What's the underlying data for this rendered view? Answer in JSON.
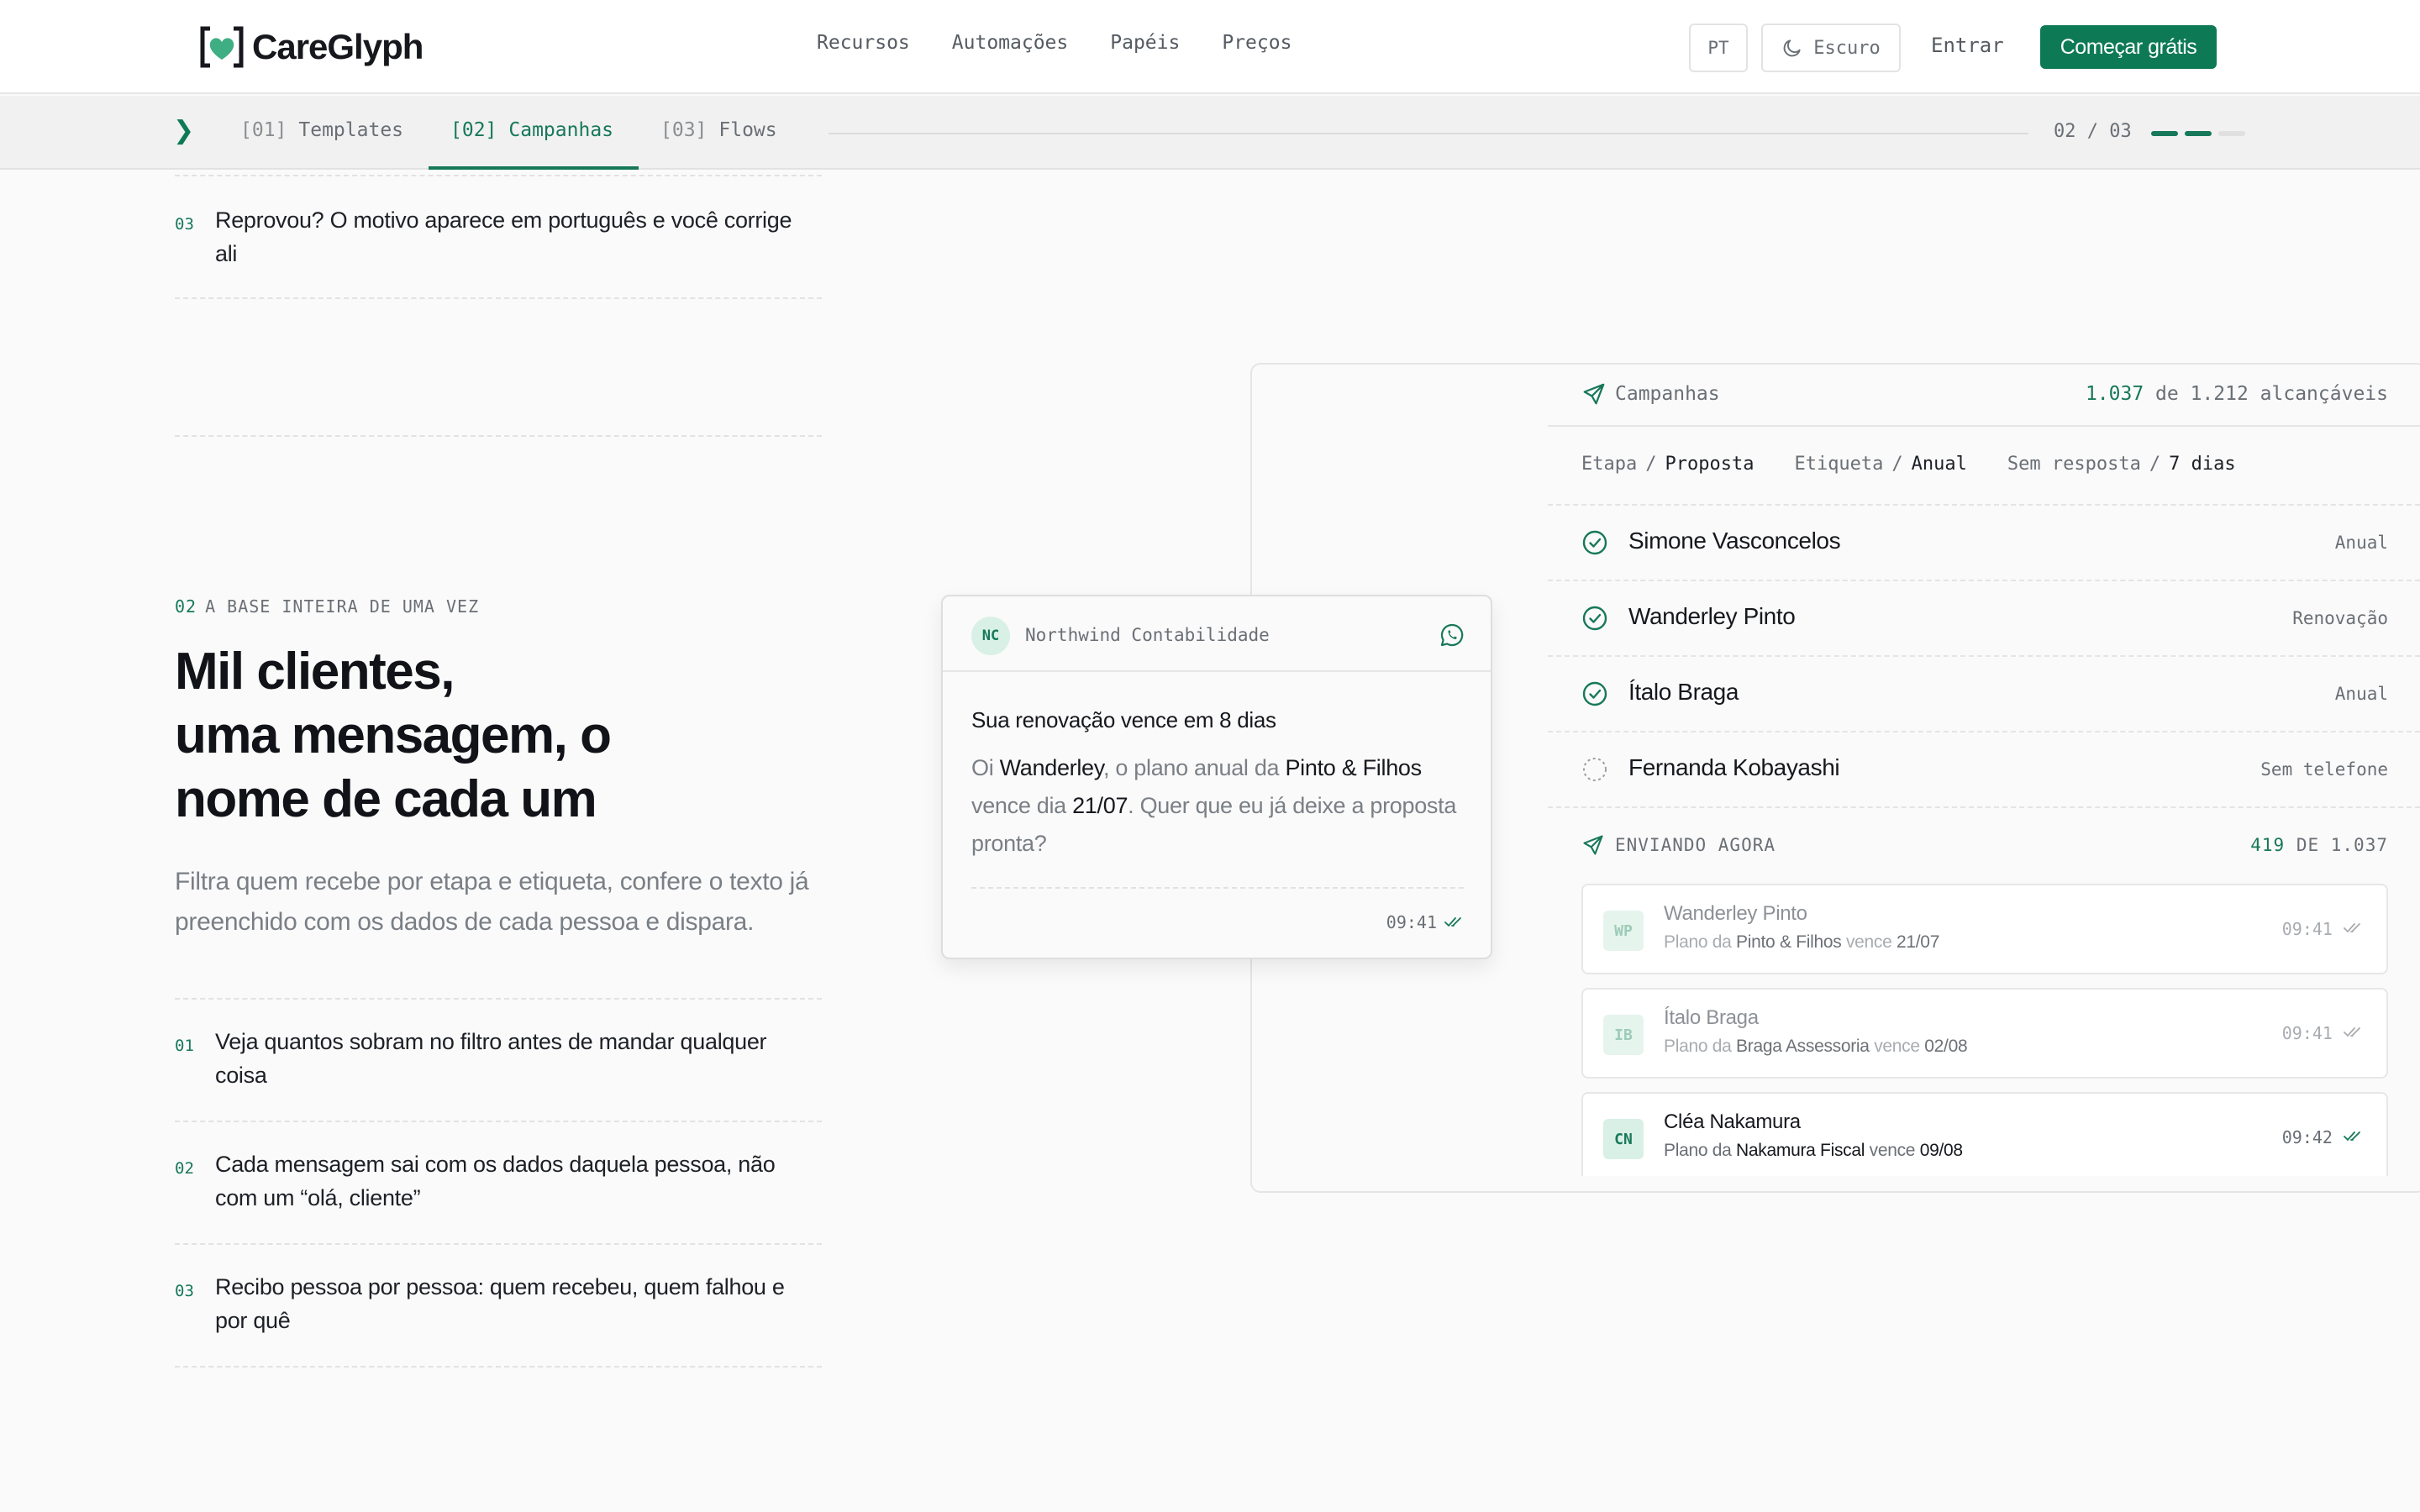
{
  "header": {
    "brand": "CareGlyph",
    "nav": [
      "Recursos",
      "Automações",
      "Papéis",
      "Preços"
    ],
    "lang": "PT",
    "theme": "Escuro",
    "login": "Entrar",
    "cta": "Começar grátis"
  },
  "tabs": {
    "items": [
      {
        "num": "[01]",
        "label": "Templates"
      },
      {
        "num": "[02]",
        "label": "Campanhas"
      },
      {
        "num": "[03]",
        "label": "Flows"
      }
    ],
    "active": 1,
    "counter": "02 / 03",
    "progress": {
      "current": 2,
      "total": 3
    }
  },
  "top_list": {
    "num": "03",
    "text": "Reprovou? O motivo aparece em português e você corrige ali"
  },
  "section": {
    "eyebrow_num": "02",
    "eyebrow": "A BASE INTEIRA DE UMA VEZ",
    "headline_1": "Mil clientes,",
    "headline_2": "uma mensagem, o",
    "headline_3": "nome de cada um",
    "subtext": "Filtra quem recebe por etapa e etiqueta, confere o texto já preenchido com os dados de cada pessoa e dispara.",
    "items": [
      {
        "num": "01",
        "text": "Veja quantos sobram no filtro antes de mandar qualquer coisa"
      },
      {
        "num": "02",
        "text": "Cada mensagem sai com os dados daquela pessoa, não com um “olá, cliente”"
      },
      {
        "num": "03",
        "text": "Recibo pessoa por pessoa: quem recebeu, quem falhou e por quê"
      }
    ]
  },
  "message": {
    "avatar": "NC",
    "org": "Northwind Contabilidade",
    "title": "Sua renovação vence em 8 dias",
    "body_1": "Oi ",
    "name": "Wanderley",
    "body_2": ", o plano anual da ",
    "company": "Pinto & Filhos",
    "body_3": " vence dia ",
    "date": "21/07",
    "body_4": ". Quer que eu já deixe a proposta pronta?",
    "time": "09:41"
  },
  "campaign": {
    "title": "Campanhas",
    "reach_value": "1.037",
    "reach_rest": "de 1.212 alcançáveis",
    "filters": [
      {
        "key": "Etapa",
        "value": "Proposta"
      },
      {
        "key": "Etiqueta",
        "value": "Anual"
      },
      {
        "key": "Sem resposta",
        "value": "7 dias"
      }
    ],
    "recipients": [
      {
        "name": "Simone Vasconcelos",
        "tag": "Anual",
        "status": "ok"
      },
      {
        "name": "Wanderley Pinto",
        "tag": "Renovação",
        "status": "ok"
      },
      {
        "name": "Ítalo Braga",
        "tag": "Anual",
        "status": "ok"
      },
      {
        "name": "Fernanda Kobayashi",
        "tag": "Sem telefone",
        "status": "skip"
      }
    ],
    "sending_label": "ENVIANDO AGORA",
    "sending_value": "419",
    "sending_rest": "DE 1.037",
    "sends": [
      {
        "initials": "WP",
        "name": "Wanderley Pinto",
        "pre": "Plano da ",
        "company": "Pinto & Filhos",
        "mid": " vence ",
        "date": "21/07",
        "time": "09:41"
      },
      {
        "initials": "IB",
        "name": "Ítalo Braga",
        "pre": "Plano da ",
        "company": "Braga Assessoria",
        "mid": " vence ",
        "date": "02/08",
        "time": "09:41"
      },
      {
        "initials": "CN",
        "name": "Cléa Nakamura",
        "pre": "Plano da ",
        "company": "Nakamura Fiscal",
        "mid": " vence ",
        "date": "09/08",
        "time": "09:42"
      }
    ]
  },
  "colors": {
    "accent": "#0e7a55",
    "accent_text": "#17785a",
    "background": "#fafafa"
  },
  "icons": {
    "logo": "heart-bracket-logo",
    "theme": "moon-icon",
    "tabs": "chevron-right-icon",
    "campaign": "send-icon",
    "message": "whatsapp-icon",
    "recipient_ok": "check-circle-icon",
    "recipient_skip": "dashed-circle-icon",
    "delivered": "double-check-icon"
  }
}
